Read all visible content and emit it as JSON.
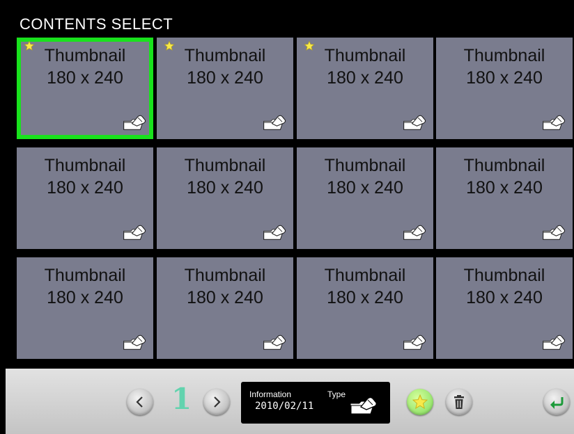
{
  "header": {
    "title": "CONTENTS SELECT"
  },
  "tiles": [
    {
      "line1": "Thumbnail",
      "line2": "180 x 240",
      "starred": true,
      "selected": true
    },
    {
      "line1": "Thumbnail",
      "line2": "180 x 240",
      "starred": true,
      "selected": false
    },
    {
      "line1": "Thumbnail",
      "line2": "180 x 240",
      "starred": true,
      "selected": false
    },
    {
      "line1": "Thumbnail",
      "line2": "180 x 240",
      "starred": false,
      "selected": false
    },
    {
      "line1": "Thumbnail",
      "line2": "180 x 240",
      "starred": false,
      "selected": false
    },
    {
      "line1": "Thumbnail",
      "line2": "180 x 240",
      "starred": false,
      "selected": false
    },
    {
      "line1": "Thumbnail",
      "line2": "180 x 240",
      "starred": false,
      "selected": false
    },
    {
      "line1": "Thumbnail",
      "line2": "180 x 240",
      "starred": false,
      "selected": false
    },
    {
      "line1": "Thumbnail",
      "line2": "180 x 240",
      "starred": false,
      "selected": false
    },
    {
      "line1": "Thumbnail",
      "line2": "180 x 240",
      "starred": false,
      "selected": false
    },
    {
      "line1": "Thumbnail",
      "line2": "180 x 240",
      "starred": false,
      "selected": false
    },
    {
      "line1": "Thumbnail",
      "line2": "180 x 240",
      "starred": false,
      "selected": false
    }
  ],
  "footer": {
    "page_number": "1",
    "info_label": "Information",
    "info_date": "2010/02/11",
    "type_label": "Type"
  },
  "icons": {
    "prev": "chevron-left-icon",
    "next": "chevron-right-icon",
    "favorite": "star-icon",
    "delete": "trash-icon",
    "back": "return-icon",
    "tile_type": "folder-hand-icon"
  },
  "colors": {
    "selection": "#19e21d",
    "tile_bg": "#7a7c8e",
    "page_number": "#62d3ae",
    "star": "#f7e94a",
    "back_arrow": "#1c9a3a"
  }
}
